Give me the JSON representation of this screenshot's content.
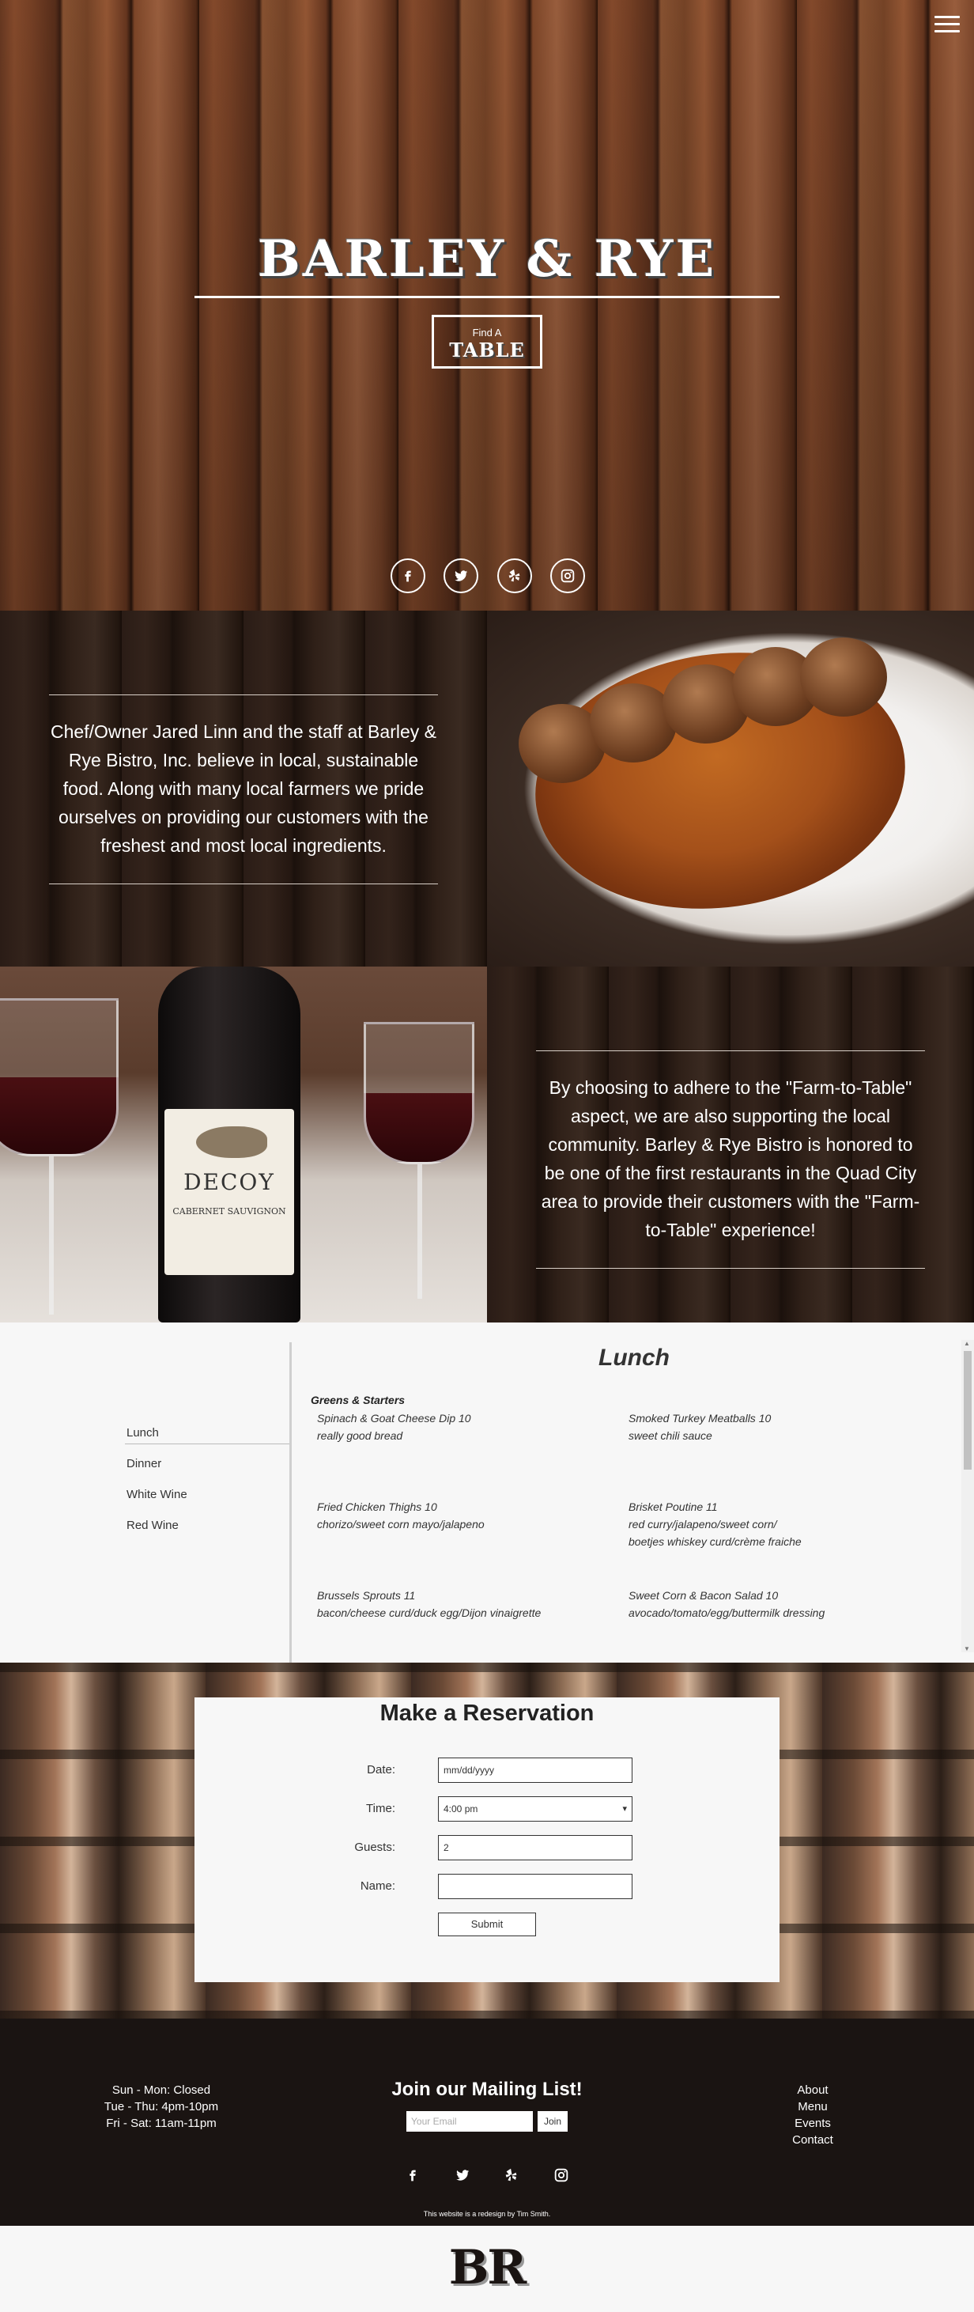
{
  "hero": {
    "title": "BARLEY & RYE",
    "find_small": "Find A",
    "find_big": "TABLE"
  },
  "about": {
    "text1": "Chef/Owner Jared Linn and the staff at Barley & Rye Bistro, Inc. believe in local, sustainable food. Along with many local farmers we pride ourselves on providing our customers with the freshest and most local ingredients.",
    "text2": "By choosing to adhere to the \"Farm-to-Table\" aspect, we are also supporting the local community. Barley & Rye Bistro is honored to be one of the first restaurants in the Quad City area to provide their customers with the \"Farm-to-Table\" experience!",
    "wine_label": "DECOY",
    "wine_sub": "CABERNET SAUVIGNON"
  },
  "menu": {
    "nav": [
      "Lunch",
      "Dinner",
      "White Wine",
      "Red Wine"
    ],
    "title": "Lunch",
    "section": "Greens & Starters",
    "dishes": [
      {
        "name": "Spinach & Goat Cheese Dip 10",
        "desc": "really good bread"
      },
      {
        "name": "Smoked Turkey Meatballs 10",
        "desc": "sweet chili sauce"
      },
      {
        "name": "Fried Chicken Thighs 10",
        "desc": "chorizo/sweet corn mayo/jalapeno"
      },
      {
        "name": "Brisket Poutine 11",
        "desc": "red curry/jalapeno/sweet corn/",
        "desc2": "boetjes whiskey curd/crème fraiche"
      },
      {
        "name": "Brussels Sprouts 11",
        "desc": "bacon/cheese curd/duck egg/Dijon vinaigrette"
      },
      {
        "name": "Sweet Corn & Bacon Salad 10",
        "desc": "avocado/tomato/egg/buttermilk dressing"
      }
    ]
  },
  "reservation": {
    "title": "Make a Reservation",
    "date_label": "Date:",
    "date_placeholder": "mm/dd/yyyy",
    "time_label": "Time:",
    "time_value": "4:00 pm",
    "guests_label": "Guests:",
    "guests_value": "2",
    "name_label": "Name:",
    "name_value": "",
    "submit_label": "Submit"
  },
  "footer": {
    "hours": [
      "Sun - Mon: Closed",
      "Tue - Thu: 4pm-10pm",
      "Fri - Sat: 11am-11pm"
    ],
    "mail_title": "Join our Mailing List!",
    "mail_placeholder": "Your Email",
    "join_label": "Join",
    "nav": [
      "About",
      "Menu",
      "Events",
      "Contact"
    ],
    "credit": "This website is a redesign by Tim Smith.",
    "logo": "BR"
  },
  "icons": [
    "menu-icon",
    "facebook-icon",
    "twitter-icon",
    "yelp-icon",
    "instagram-icon"
  ]
}
